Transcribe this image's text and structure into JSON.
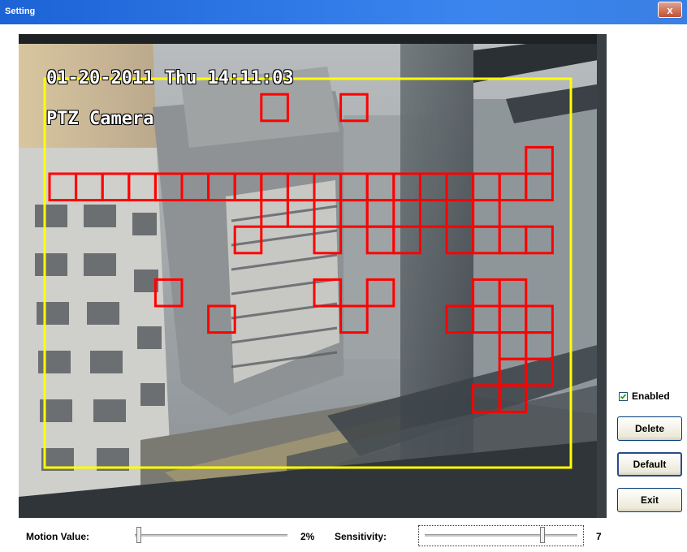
{
  "window": {
    "title": "Setting",
    "close_label": "x"
  },
  "video": {
    "osd_datetime": "01-20-2011 Thu 14:11:03",
    "osd_camera": "PTZ Camera",
    "zone_color": "#ffff00",
    "motion_cell_color": "#ff0000"
  },
  "controls": {
    "enabled": {
      "label": "Enabled",
      "checked": true
    },
    "delete_label": "Delete",
    "default_label": "Default",
    "exit_label": "Exit"
  },
  "motion": {
    "label": "Motion Value:",
    "value_text": "2%",
    "value": 2
  },
  "sensitivity": {
    "label": "Sensitivity:",
    "value_text": "7",
    "value": 7
  }
}
